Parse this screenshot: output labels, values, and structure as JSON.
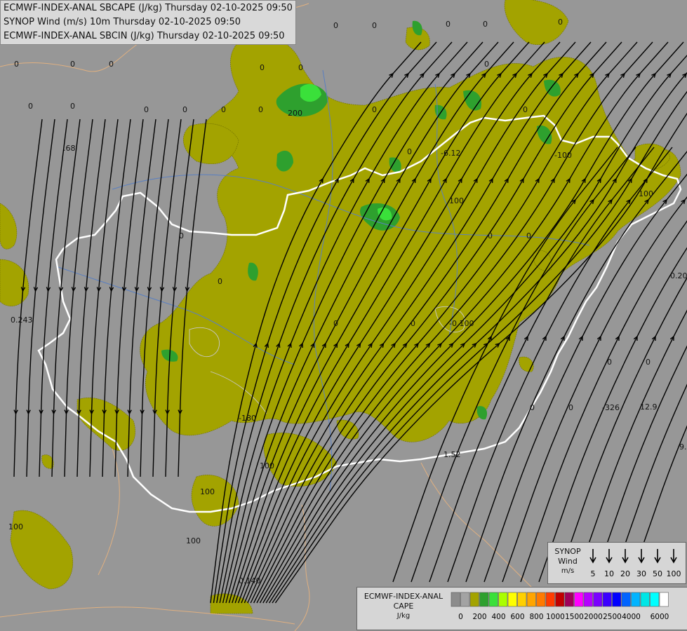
{
  "titles": {
    "line1": "ECMWF-INDEX-ANAL SBCAPE (J/kg) Thursday 02-10-2025 09:50",
    "line2": "SYNOP Wind (m/s) 10m Thursday 02-10-2025 09:50",
    "line3": "ECMWF-INDEX-ANAL SBCIN (J/kg) Thursday 02-10-2025 09:50"
  },
  "colors": {
    "background": "#979797",
    "cape_fill": "#a3a300",
    "cape_green_mid": "#2ea02e",
    "cape_green_high": "#3ae03a",
    "border_country": "#ffffff",
    "border_region": "#e0b080",
    "rivers": "#5a7fc0",
    "streamlines": "#000000"
  },
  "map_labels": [
    {
      "text": "0",
      "id": "a1"
    },
    {
      "text": "0",
      "id": "a2"
    },
    {
      "text": "0",
      "id": "a3"
    },
    {
      "text": "0",
      "id": "a4"
    },
    {
      "text": "0",
      "id": "a5"
    },
    {
      "text": "0",
      "id": "a6"
    },
    {
      "text": "0",
      "id": "a7"
    },
    {
      "text": "0",
      "id": "a8"
    },
    {
      "text": "0",
      "id": "a9"
    },
    {
      "text": "0",
      "id": "a10"
    },
    {
      "text": "0",
      "id": "a11"
    },
    {
      "text": "0",
      "id": "a12"
    },
    {
      "text": "0",
      "id": "a13"
    },
    {
      "text": "0",
      "id": "a14"
    },
    {
      "text": "0",
      "id": "a15"
    },
    {
      "text": "0",
      "id": "a16"
    },
    {
      "text": "0",
      "id": "a17"
    },
    {
      "text": "0",
      "id": "a18"
    },
    {
      "text": "0",
      "id": "a19"
    },
    {
      "text": "0",
      "id": "a20"
    },
    {
      "text": "0",
      "id": "a21"
    },
    {
      "text": "0",
      "id": "a22"
    },
    {
      "text": "0",
      "id": "a23"
    },
    {
      "text": "0",
      "id": "a24"
    },
    {
      "text": "0",
      "id": "a25"
    },
    {
      "text": "0",
      "id": "a26"
    },
    {
      "text": "0",
      "id": "a27"
    },
    {
      "text": "0",
      "id": "a28"
    },
    {
      "text": "0",
      "id": "a29"
    },
    {
      "text": "0",
      "id": "a30"
    },
    {
      "text": ".68",
      "id": "b1"
    },
    {
      "text": "0.243",
      "id": "b2"
    },
    {
      "text": "-6.12",
      "id": "b3"
    },
    {
      "text": "12.9",
      "id": "b4"
    },
    {
      "text": "-326",
      "id": "b5"
    },
    {
      "text": "1.52",
      "id": "b6"
    },
    {
      "text": "0.140",
      "id": "b7"
    },
    {
      "text": "0.20",
      "id": "b8"
    },
    {
      "text": "9.",
      "id": "b9"
    },
    {
      "text": "100",
      "id": "c1"
    },
    {
      "text": "100",
      "id": "c2"
    },
    {
      "text": "100",
      "id": "c3"
    },
    {
      "text": "100",
      "id": "c4"
    },
    {
      "text": "100",
      "id": "c5"
    },
    {
      "text": "100",
      "id": "c6"
    },
    {
      "text": "200",
      "id": "c7"
    },
    {
      "text": "-100",
      "id": "c8"
    },
    {
      "text": "-0.100",
      "id": "c9"
    },
    {
      "text": "-180",
      "id": "c10"
    }
  ],
  "wind_legend": {
    "title1": "SYNOP",
    "title2": "Wind",
    "unit": "m/s",
    "speeds": [
      "5",
      "10",
      "20",
      "30",
      "50",
      "100"
    ]
  },
  "cape_legend": {
    "title1": "ECMWF-INDEX-ANAL",
    "title2": "CAPE",
    "unit": "J/kg",
    "swatch_colors": [
      "#8c8c8c",
      "#a3a3a3",
      "#a3a300",
      "#2ea02e",
      "#3ae03a",
      "#aaff00",
      "#ffff00",
      "#ffd000",
      "#ffa500",
      "#ff7a00",
      "#ff3c00",
      "#c00000",
      "#a0005a",
      "#ff00ff",
      "#b400ff",
      "#7a00ff",
      "#3c00ff",
      "#0000ff",
      "#0064ff",
      "#00b4ff",
      "#00e6e6",
      "#00ffff",
      "#ffffff"
    ],
    "ticks": [
      "0",
      "200",
      "400",
      "600",
      "800",
      "1000",
      "1500",
      "2000",
      "2500",
      "4000",
      "6000"
    ]
  }
}
